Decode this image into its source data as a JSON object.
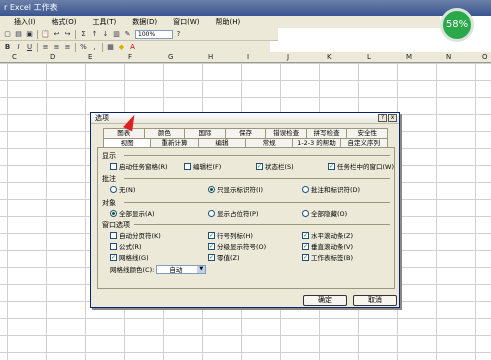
{
  "window": {
    "title": "r Excel 工作表"
  },
  "menu": [
    "插入(I)",
    "格式(O)",
    "工具(T)",
    "数据(D)",
    "窗口(W)",
    "帮助(H)"
  ],
  "toolbar1": [
    "📋",
    "Σ",
    "↩",
    "↪",
    "Σ",
    "f"
  ],
  "toolbar2": [
    "B",
    "I",
    "U",
    "≡",
    "≡",
    "≡",
    "%",
    ","
  ],
  "zoom": "100%",
  "badge": {
    "value": "58%",
    "color": "#2ba84a"
  },
  "columns": [
    "C",
    "D",
    "E",
    "F",
    "G",
    "H",
    "I",
    "J",
    "K",
    "L",
    "M",
    "N",
    "O"
  ],
  "dialog": {
    "title": "选项",
    "help": "?",
    "close": "x",
    "tabs_top": [
      "图表",
      "颜色",
      "国际",
      "保存",
      "错误检查",
      "拼写检查",
      "安全性"
    ],
    "tabs_bottom": [
      "视图",
      "重新计算",
      "编辑",
      "常规",
      "1-2-3 的帮助",
      "自定义序列"
    ],
    "sections": {
      "display": {
        "label": "显示",
        "options": [
          {
            "label": "启动任务窗格(R)",
            "checked": false
          },
          {
            "label": "编辑栏(F)",
            "checked": false
          },
          {
            "label": "状态栏(S)",
            "checked": true
          },
          {
            "label": "任务栏中的窗口(W)",
            "checked": true
          }
        ]
      },
      "comments": {
        "label": "批注",
        "options": [
          {
            "label": "无(N)",
            "selected": false
          },
          {
            "label": "只显示标识符(I)",
            "selected": true
          },
          {
            "label": "批注和标识符(D)",
            "selected": false
          }
        ]
      },
      "objects": {
        "label": "对象",
        "options": [
          {
            "label": "全部显示(A)",
            "selected": true
          },
          {
            "label": "显示占位符(P)",
            "selected": false
          },
          {
            "label": "全部隐藏(O)",
            "selected": false
          }
        ]
      },
      "window": {
        "label": "窗口选项",
        "options": [
          {
            "label": "自动分页符(K)",
            "checked": false
          },
          {
            "label": "行号列标(H)",
            "checked": true
          },
          {
            "label": "水平滚动条(Z)",
            "checked": true
          },
          {
            "label": "公式(R)",
            "checked": false
          },
          {
            "label": "分级显示符号(O)",
            "checked": true
          },
          {
            "label": "垂直滚动条(V)",
            "checked": true
          },
          {
            "label": "网格线(G)",
            "checked": true
          },
          {
            "label": "零值(Z)",
            "checked": true
          },
          {
            "label": "工作表标签(B)",
            "checked": true
          }
        ]
      },
      "gridcolor": {
        "label": "网格线颜色(C):",
        "value": "自动"
      }
    },
    "ok": "确定",
    "cancel": "取消"
  }
}
